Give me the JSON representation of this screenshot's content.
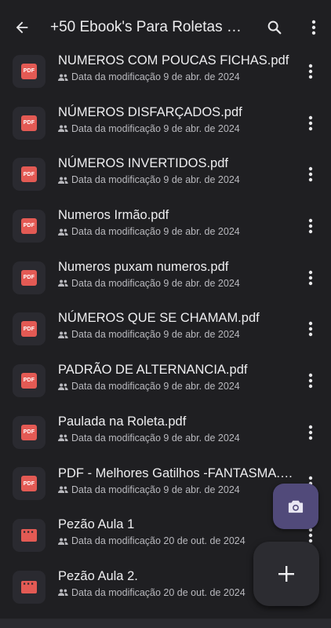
{
  "topbar": {
    "title": "+50 Ebook's Para Roletas e…",
    "icons": [
      "back-arrow-icon",
      "search-icon",
      "more-vert-icon"
    ]
  },
  "files": [
    {
      "name": "NÚMEROS COM POUCAS FICHAS.pdf",
      "meta": "Data da modificação 9 de abr. de 2024",
      "type": "pdf"
    },
    {
      "name": "NÚMEROS DISFARÇADOS.pdf",
      "meta": "Data da modificação 9 de abr. de 2024",
      "type": "pdf"
    },
    {
      "name": "NÚMEROS INVERTIDOS.pdf",
      "meta": "Data da modificação 9 de abr. de 2024",
      "type": "pdf"
    },
    {
      "name": "Numeros Irmão.pdf",
      "meta": "Data da modificação 9 de abr. de 2024",
      "type": "pdf"
    },
    {
      "name": "Numeros puxam numeros.pdf",
      "meta": "Data da modificação 9 de abr. de 2024",
      "type": "pdf"
    },
    {
      "name": "NÚMEROS QUE SE CHAMAM.pdf",
      "meta": "Data da modificação 9 de abr. de 2024",
      "type": "pdf"
    },
    {
      "name": "PADRÃO DE ALTERNANCIA.pdf",
      "meta": "Data da modificação 9 de abr. de 2024",
      "type": "pdf"
    },
    {
      "name": "Paulada na Roleta.pdf",
      "meta": "Data da modificação 9 de abr. de 2024",
      "type": "pdf"
    },
    {
      "name": "PDF - Melhores Gatilhos -FANTASMA.pdf",
      "meta": "Data da modificação 9 de abr. de 2024",
      "type": "pdf"
    },
    {
      "name": "Pezão Aula 1",
      "meta": "Data da modificação 20 de out. de 2024",
      "type": "video"
    },
    {
      "name": "Pezão Aula 2.",
      "meta": "Data da modificação 20 de out. de 2024",
      "type": "video"
    }
  ],
  "pdf_badge": "PDF",
  "colors": {
    "background": "#1f1f22",
    "pdf_red": "#e35a54",
    "fab_camera": "#514a7a"
  },
  "fabs": {
    "camera_icon": "camera-icon",
    "add_icon": "plus-icon"
  }
}
